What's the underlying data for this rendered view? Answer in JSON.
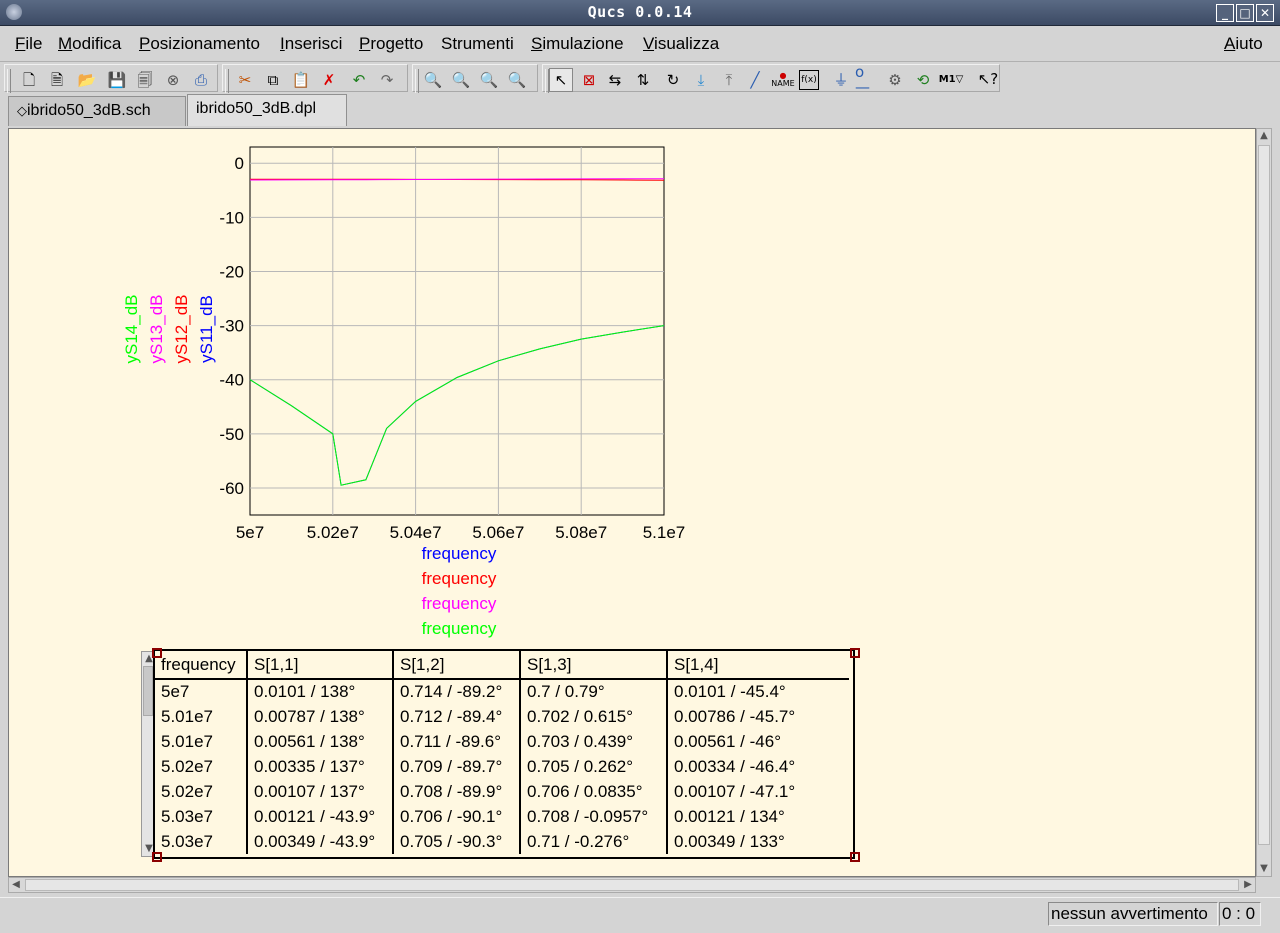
{
  "window": {
    "title": "Qucs 0.0.14"
  },
  "menu": [
    {
      "u": "F",
      "rest": "ile"
    },
    {
      "u": "M",
      "rest": "odifica"
    },
    {
      "u": "P",
      "rest": "osizionamento"
    },
    {
      "u": "I",
      "rest": "nserisci"
    },
    {
      "u": "P",
      "rest": "rogetto"
    },
    {
      "u": "",
      "rest": "Strumenti"
    },
    {
      "u": "S",
      "rest": "imulazione"
    },
    {
      "u": "V",
      "rest": "isualizza"
    }
  ],
  "menu_help": {
    "u": "A",
    "rest": "iuto"
  },
  "tabs": [
    {
      "label": "ibrido50_3dB.sch"
    },
    {
      "label": "ibrido50_3dB.dpl"
    }
  ],
  "colors": {
    "s11": "#0000ff",
    "s12": "#ff0000",
    "s13": "#ff00ff",
    "s14": "#00ff00",
    "canvas": "#fff8e1"
  },
  "chart_data": {
    "type": "line",
    "xlabel": "frequency",
    "xlim": [
      50000000,
      51000000
    ],
    "ylim": [
      -65,
      3
    ],
    "x_ticks": [
      "5e7",
      "5.02e7",
      "5.04e7",
      "5.06e7",
      "5.08e7",
      "5.1e7"
    ],
    "y_ticks": [
      "0",
      "-10",
      "-20",
      "-30",
      "-40",
      "-50",
      "-60"
    ],
    "grid": true,
    "legend": {
      "y_labels": [
        "yS14_dB",
        "yS13_dB",
        "yS12_dB",
        "yS11_dB"
      ],
      "x_labels": [
        "frequency",
        "frequency",
        "frequency",
        "frequency"
      ]
    },
    "x": [
      50000000,
      50100000,
      50200000,
      50220000,
      50280000,
      50330000,
      50400000,
      50500000,
      50600000,
      50700000,
      50800000,
      50900000,
      51000000
    ],
    "series": [
      {
        "name": "yS11_dB",
        "color": "#0000ff",
        "values": [
          -40,
          -44.8,
          -50,
          -59.5,
          -58.5,
          -49,
          -44,
          -39.6,
          -36.5,
          -34.3,
          -32.5,
          -31.2,
          -30
        ]
      },
      {
        "name": "yS12_dB",
        "color": "#ff0000",
        "values": [
          -2.95,
          -2.95,
          -2.96,
          -2.96,
          -2.96,
          -2.97,
          -2.98,
          -3.0,
          -3.02,
          -3.04,
          -3.07,
          -3.1,
          -3.15
        ]
      },
      {
        "name": "yS13_dB",
        "color": "#ff00ff",
        "values": [
          -3.1,
          -3.08,
          -3.05,
          -3.05,
          -3.04,
          -3.02,
          -3.0,
          -2.97,
          -2.94,
          -2.92,
          -2.9,
          -2.88,
          -2.85
        ]
      },
      {
        "name": "yS14_dB",
        "color": "#00ff00",
        "values": [
          -40,
          -44.8,
          -50,
          -59.5,
          -58.5,
          -49,
          -44,
          -39.6,
          -36.5,
          -34.3,
          -32.5,
          -31.2,
          -30
        ]
      }
    ]
  },
  "table": {
    "headers": [
      "frequency",
      "S[1,1]",
      "S[1,2]",
      "S[1,3]",
      "S[1,4]"
    ],
    "rows": [
      [
        "5e7",
        "0.0101 / 138°",
        "0.714 / -89.2°",
        "0.7 / 0.79°",
        "0.0101 / -45.4°"
      ],
      [
        "5.01e7",
        "0.00787 / 138°",
        "0.712 / -89.4°",
        "0.702 / 0.615°",
        "0.00786 / -45.7°"
      ],
      [
        "5.01e7",
        "0.00561 / 138°",
        "0.711 / -89.6°",
        "0.703 / 0.439°",
        "0.00561 / -46°"
      ],
      [
        "5.02e7",
        "0.00335 / 137°",
        "0.709 / -89.7°",
        "0.705 / 0.262°",
        "0.00334 / -46.4°"
      ],
      [
        "5.02e7",
        "0.00107 / 137°",
        "0.708 / -89.9°",
        "0.706 / 0.0835°",
        "0.00107 / -47.1°"
      ],
      [
        "5.03e7",
        "0.00121 / -43.9°",
        "0.706 / -90.1°",
        "0.708 / -0.0957°",
        "0.00121 / 134°"
      ],
      [
        "5.03e7",
        "0.00349 / -43.9°",
        "0.705 / -90.3°",
        "0.71 / -0.276°",
        "0.00349 / 133°"
      ]
    ]
  },
  "status": {
    "message": "nessun avvertimento",
    "position": "0 : 0"
  }
}
